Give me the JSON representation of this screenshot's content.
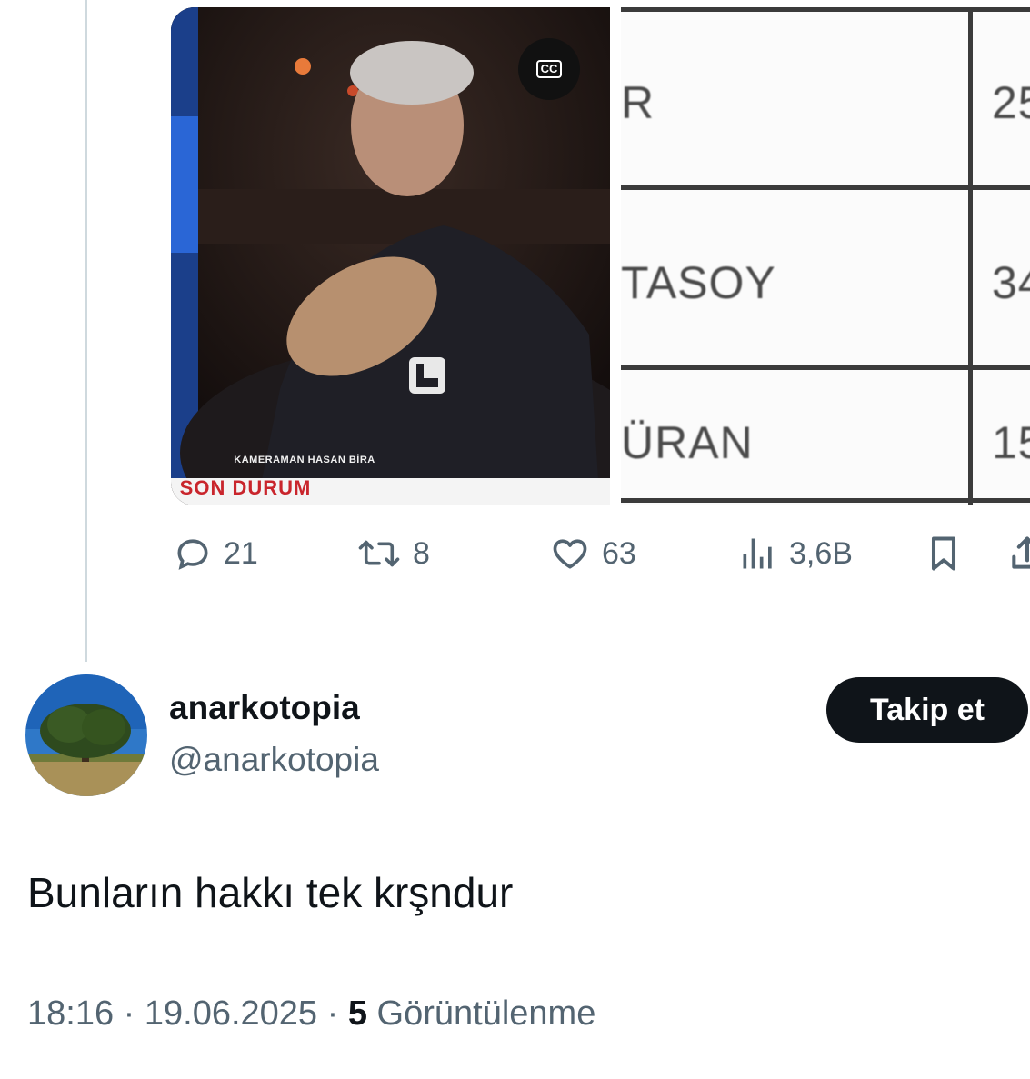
{
  "media": {
    "video": {
      "cc_label": "CC",
      "caption_small": "KAMERAMAN HASAN BİRA",
      "caption_main": "SON DURUM"
    },
    "document": {
      "names": [
        "R",
        "TASOY",
        "ÜRAN"
      ],
      "numbers": [
        "25",
        "34",
        "15"
      ]
    }
  },
  "actions": {
    "replies": "21",
    "retweets": "8",
    "likes": "63",
    "views": "3,6B"
  },
  "author": {
    "display_name": "anarkotopia",
    "handle": "@anarkotopia",
    "follow_label": "Takip et"
  },
  "tweet": {
    "text": "Bunların hakkı tek krşndur",
    "time": "18:16",
    "separator": "·",
    "date": "19.06.2025",
    "views_count": "5",
    "views_label": "Görüntülenme"
  },
  "colors": {
    "text_primary": "#0f1419",
    "text_secondary": "#536471",
    "button_bg": "#0f1419",
    "caption_red": "#c9252c"
  }
}
